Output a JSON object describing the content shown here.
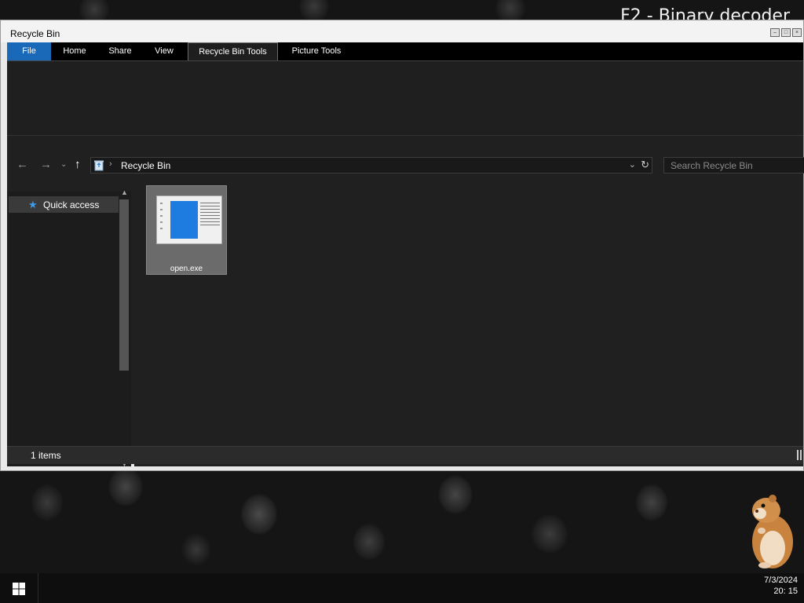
{
  "desktop": {
    "title": "F2 - Binary decoder"
  },
  "window": {
    "title": "Recycle Bin",
    "tabs": [
      {
        "label": "File"
      },
      {
        "label": "Home"
      },
      {
        "label": "Share"
      },
      {
        "label": "View"
      },
      {
        "label": "Recycle Bin Tools"
      },
      {
        "label": "Picture Tools"
      }
    ],
    "address": {
      "breadcrumb": "Recycle Bin"
    },
    "search": {
      "placeholder": "Search Recycle Bin"
    },
    "nav": {
      "quick_access": "Quick access"
    },
    "files": [
      {
        "name": "open.exe"
      }
    ],
    "status": {
      "item_count": "1 items"
    }
  },
  "taskbar": {
    "date": "7/3/2024",
    "time": "20: 15"
  },
  "colors": {
    "accent": "#1a69b8",
    "quick_access_star": "#3a9ff0",
    "thumbnail_blue": "#1e7ce0"
  }
}
